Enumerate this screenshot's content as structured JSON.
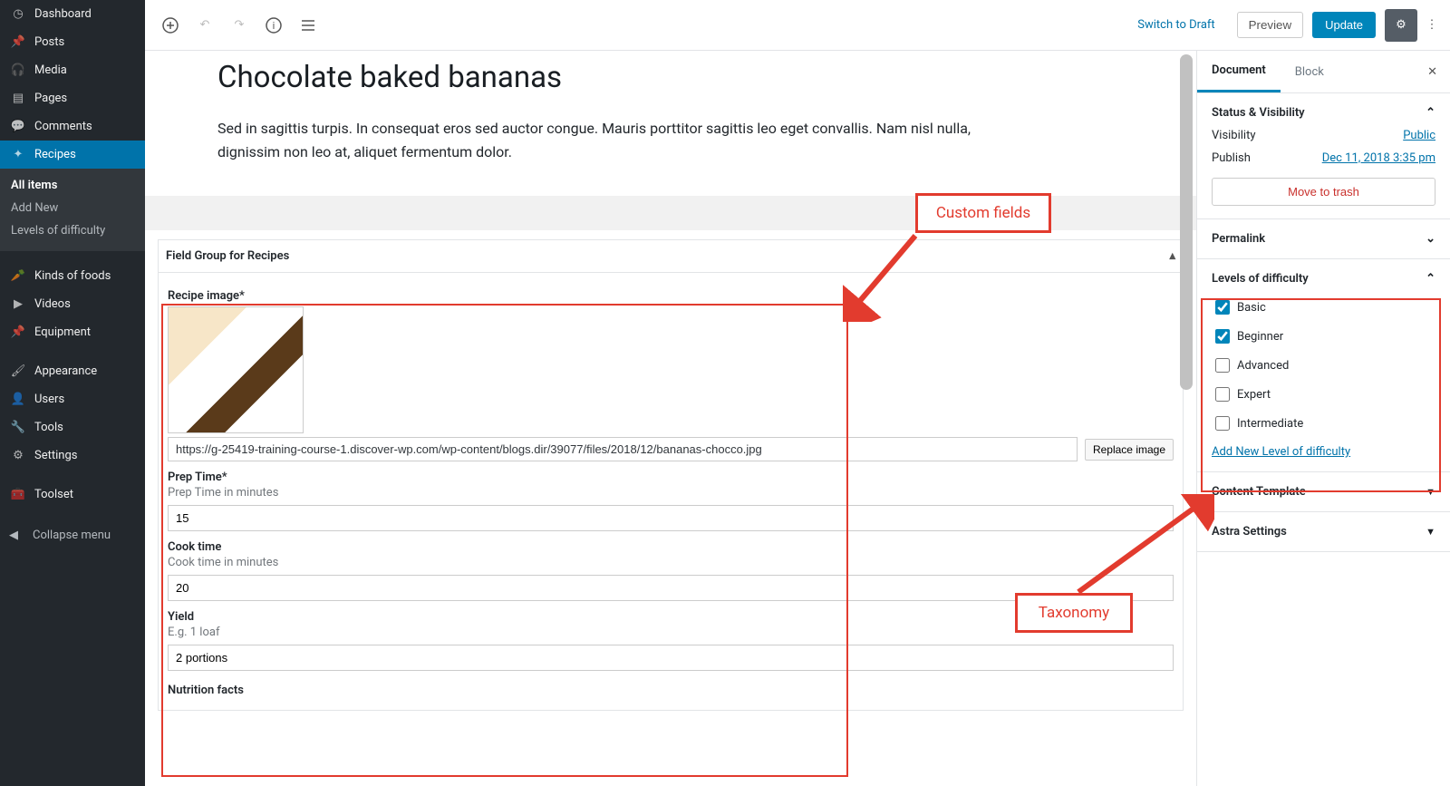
{
  "sidebar": {
    "items": [
      {
        "icon": "dashboard",
        "label": "Dashboard"
      },
      {
        "icon": "pin",
        "label": "Posts"
      },
      {
        "icon": "media",
        "label": "Media"
      },
      {
        "icon": "page",
        "label": "Pages"
      },
      {
        "icon": "comment",
        "label": "Comments"
      },
      {
        "icon": "star",
        "label": "Recipes",
        "active": true
      },
      {
        "icon": "carrot",
        "label": "Kinds of foods"
      },
      {
        "icon": "video",
        "label": "Videos"
      },
      {
        "icon": "pin",
        "label": "Equipment"
      },
      {
        "icon": "brush",
        "label": "Appearance"
      },
      {
        "icon": "user",
        "label": "Users"
      },
      {
        "icon": "wrench",
        "label": "Tools"
      },
      {
        "icon": "settings",
        "label": "Settings"
      },
      {
        "icon": "toolset",
        "label": "Toolset"
      }
    ],
    "sub": [
      {
        "label": "All items",
        "current": true
      },
      {
        "label": "Add New"
      },
      {
        "label": "Levels of difficulty"
      }
    ],
    "collapse": "Collapse menu"
  },
  "topbar": {
    "switch_draft": "Switch to Draft",
    "preview": "Preview",
    "update": "Update"
  },
  "post": {
    "title": "Chocolate baked bananas",
    "body": "Sed in sagittis turpis. In consequat eros sed auctor congue. Mauris porttitor sagittis leo eget convallis. Nam nisl nulla, dignissim non leo at, aliquet fermentum dolor."
  },
  "meta": {
    "group_title": "Field Group for Recipes",
    "image_label": "Recipe image*",
    "image_path": "https://g-25419-training-course-1.discover-wp.com/wp-content/blogs.dir/39077/files/2018/12/bananas-chocco.jpg",
    "replace": "Replace image",
    "prep_label": "Prep Time*",
    "prep_help": "Prep Time in minutes",
    "prep_value": "15",
    "cook_label": "Cook time",
    "cook_help": "Cook time in minutes",
    "cook_value": "20",
    "yield_label": "Yield",
    "yield_help": "E.g. 1 loaf",
    "yield_value": "2 portions",
    "nutrition_label": "Nutrition facts"
  },
  "tabs": {
    "document": "Document",
    "block": "Block"
  },
  "status_panel": {
    "title": "Status & Visibility",
    "vis_label": "Visibility",
    "vis_value": "Public",
    "pub_label": "Publish",
    "pub_value": "Dec 11, 2018 3:35 pm",
    "trash": "Move to trash"
  },
  "permalink_panel": {
    "title": "Permalink"
  },
  "levels_panel": {
    "title": "Levels of difficulty",
    "items": [
      {
        "label": "Basic",
        "checked": true
      },
      {
        "label": "Beginner",
        "checked": true
      },
      {
        "label": "Advanced",
        "checked": false
      },
      {
        "label": "Expert",
        "checked": false
      },
      {
        "label": "Intermediate",
        "checked": false
      }
    ],
    "add_new": "Add New Level of difficulty"
  },
  "template_panel": {
    "title": "Content Template"
  },
  "astra_panel": {
    "title": "Astra Settings"
  },
  "annotations": {
    "custom_fields": "Custom fields",
    "taxonomy": "Taxonomy"
  },
  "icons": {
    "dashboard": "◷",
    "pin": "📌",
    "media": "🎧",
    "page": "▤",
    "comment": "💬",
    "star": "✦",
    "carrot": "🥕",
    "video": "▶",
    "brush": "🖌",
    "user": "👤",
    "wrench": "🔧",
    "settings": "⚙",
    "toolset": "🧰",
    "collapse": "◀"
  }
}
